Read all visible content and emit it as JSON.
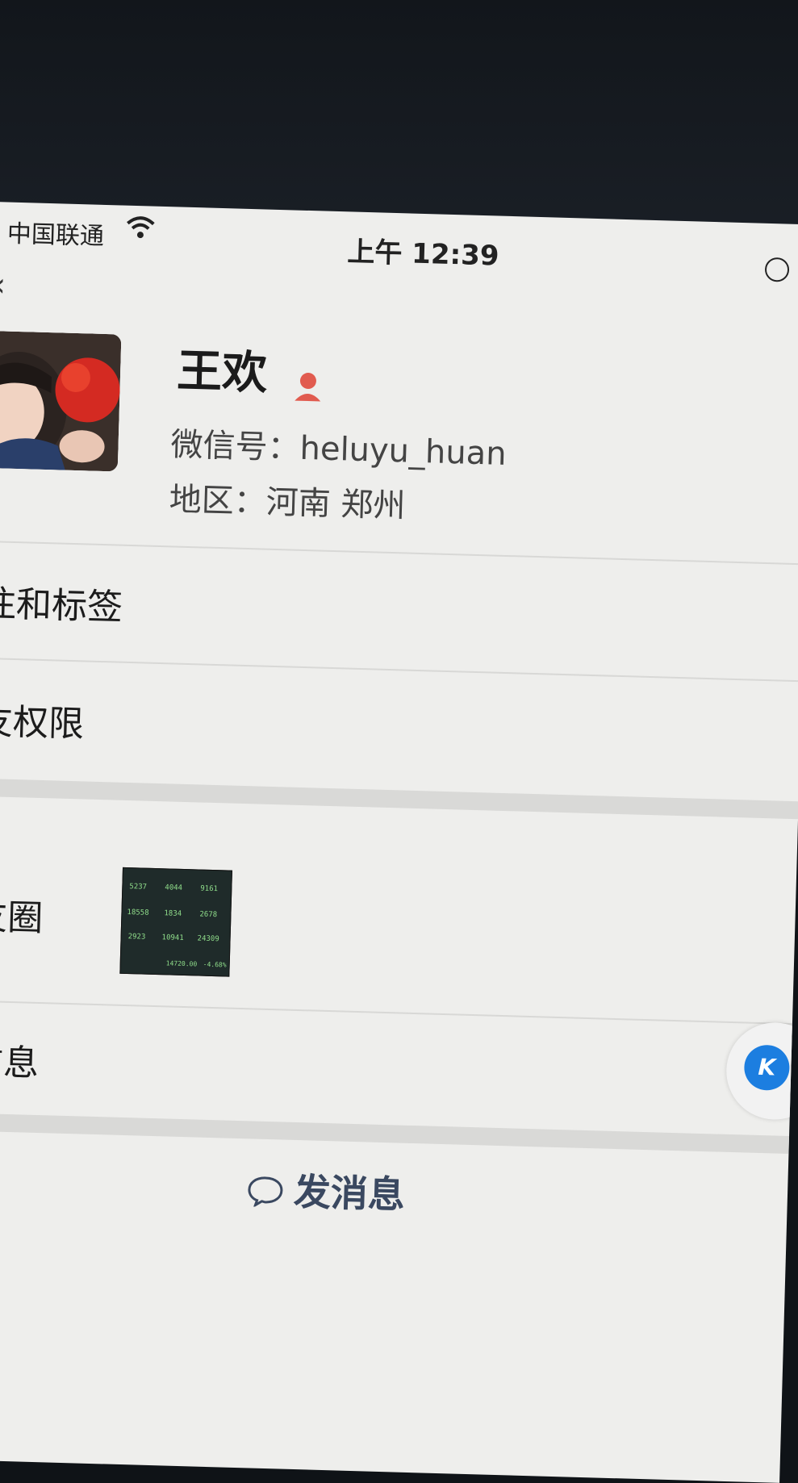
{
  "status_bar": {
    "carrier": "中国联通",
    "time": "上午 12:39"
  },
  "profile": {
    "name": "王欢",
    "wechat_id": "微信号：heluyu_huan",
    "region": "地区：河南 郑州"
  },
  "rows": {
    "remark_tags": "注和标签",
    "friend_permissions": "友权限",
    "moments": "友圈",
    "more_info": "信息"
  },
  "moments_thumbnail": {
    "cells": [
      "5237",
      "4044",
      "9161",
      "18558",
      "1834",
      "2678",
      "2923",
      "10941",
      "24309",
      "14720.00",
      "-4.68%"
    ]
  },
  "floating_button": {
    "label": "K"
  },
  "actions": {
    "send_message": "发消息"
  },
  "colors": {
    "accent": "#1c7ee0",
    "female_icon": "#e15b4f",
    "background": "#eeeeec"
  }
}
